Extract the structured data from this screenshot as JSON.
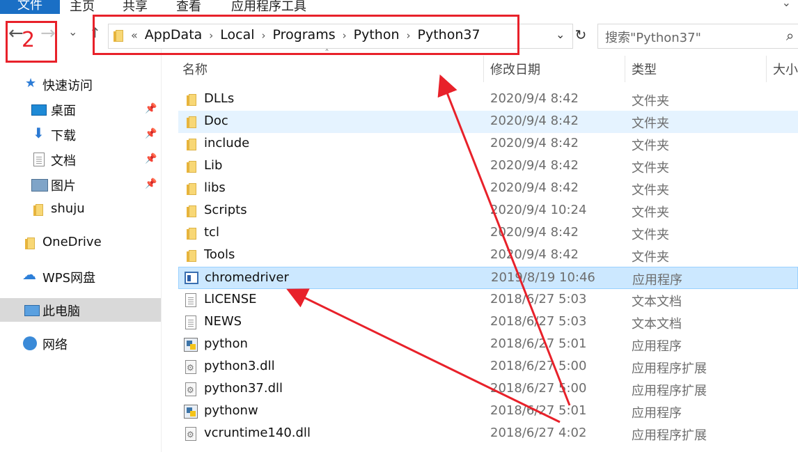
{
  "ribbon": {
    "tabs": [
      "文件",
      "主页",
      "共享",
      "查看",
      "应用程序工具"
    ]
  },
  "nav": {
    "back": "←",
    "forward": "→",
    "recent": "⌄",
    "up": "↑"
  },
  "address": {
    "overflow": "«",
    "crumbs": [
      "AppData",
      "Local",
      "Programs",
      "Python",
      "Python37"
    ],
    "separator": "›"
  },
  "search": {
    "placeholder": "搜索\"Python37\""
  },
  "sidebar": {
    "items": [
      {
        "label": "快速访问",
        "icon": "star-icon"
      },
      {
        "label": "桌面",
        "icon": "desktop-icon",
        "pinned": true
      },
      {
        "label": "下载",
        "icon": "download-icon",
        "pinned": true
      },
      {
        "label": "文档",
        "icon": "document-icon",
        "pinned": true
      },
      {
        "label": "图片",
        "icon": "picture-icon",
        "pinned": true
      },
      {
        "label": "shuju",
        "icon": "folder-icon"
      },
      {
        "label": "OneDrive",
        "icon": "folder-icon"
      },
      {
        "label": "WPS网盘",
        "icon": "cloud-icon"
      },
      {
        "label": "此电脑",
        "icon": "computer-icon",
        "selected": true
      },
      {
        "label": "网络",
        "icon": "network-icon"
      }
    ]
  },
  "columns": {
    "name": "名称",
    "date": "修改日期",
    "type": "类型",
    "size": "大小"
  },
  "files": [
    {
      "name": "DLLs",
      "date": "2020/9/4 8:42",
      "type": "文件夹",
      "icon": "folder-icon"
    },
    {
      "name": "Doc",
      "date": "2020/9/4 8:42",
      "type": "文件夹",
      "icon": "folder-icon"
    },
    {
      "name": "include",
      "date": "2020/9/4 8:42",
      "type": "文件夹",
      "icon": "folder-icon"
    },
    {
      "name": "Lib",
      "date": "2020/9/4 8:42",
      "type": "文件夹",
      "icon": "folder-icon"
    },
    {
      "name": "libs",
      "date": "2020/9/4 8:42",
      "type": "文件夹",
      "icon": "folder-icon"
    },
    {
      "name": "Scripts",
      "date": "2020/9/4 10:24",
      "type": "文件夹",
      "icon": "folder-icon"
    },
    {
      "name": "tcl",
      "date": "2020/9/4 8:42",
      "type": "文件夹",
      "icon": "folder-icon"
    },
    {
      "name": "Tools",
      "date": "2020/9/4 8:42",
      "type": "文件夹",
      "icon": "folder-icon"
    },
    {
      "name": "chromedriver",
      "date": "2019/8/19 10:46",
      "type": "应用程序",
      "icon": "exe-icon"
    },
    {
      "name": "LICENSE",
      "date": "2018/6/27 5:03",
      "type": "文本文档",
      "icon": "text-file-icon"
    },
    {
      "name": "NEWS",
      "date": "2018/6/27 5:03",
      "type": "文本文档",
      "icon": "text-file-icon"
    },
    {
      "name": "python",
      "date": "2018/6/27 5:01",
      "type": "应用程序",
      "icon": "python-icon"
    },
    {
      "name": "python3.dll",
      "date": "2018/6/27 5:00",
      "type": "应用程序扩展",
      "icon": "dll-icon"
    },
    {
      "name": "python37.dll",
      "date": "2018/6/27 5:00",
      "type": "应用程序扩展",
      "icon": "dll-icon"
    },
    {
      "name": "pythonw",
      "date": "2018/6/27 5:01",
      "type": "应用程序",
      "icon": "python-icon"
    },
    {
      "name": "vcruntime140.dll",
      "date": "2018/6/27 4:02",
      "type": "应用程序扩展",
      "icon": "dll-icon"
    }
  ],
  "annotation": {
    "step_number": "2",
    "color": "#e8212a"
  },
  "colors": {
    "accent": "#1a6fc5",
    "selected_row": "#cce8ff",
    "hover_row": "#e5f3ff"
  }
}
